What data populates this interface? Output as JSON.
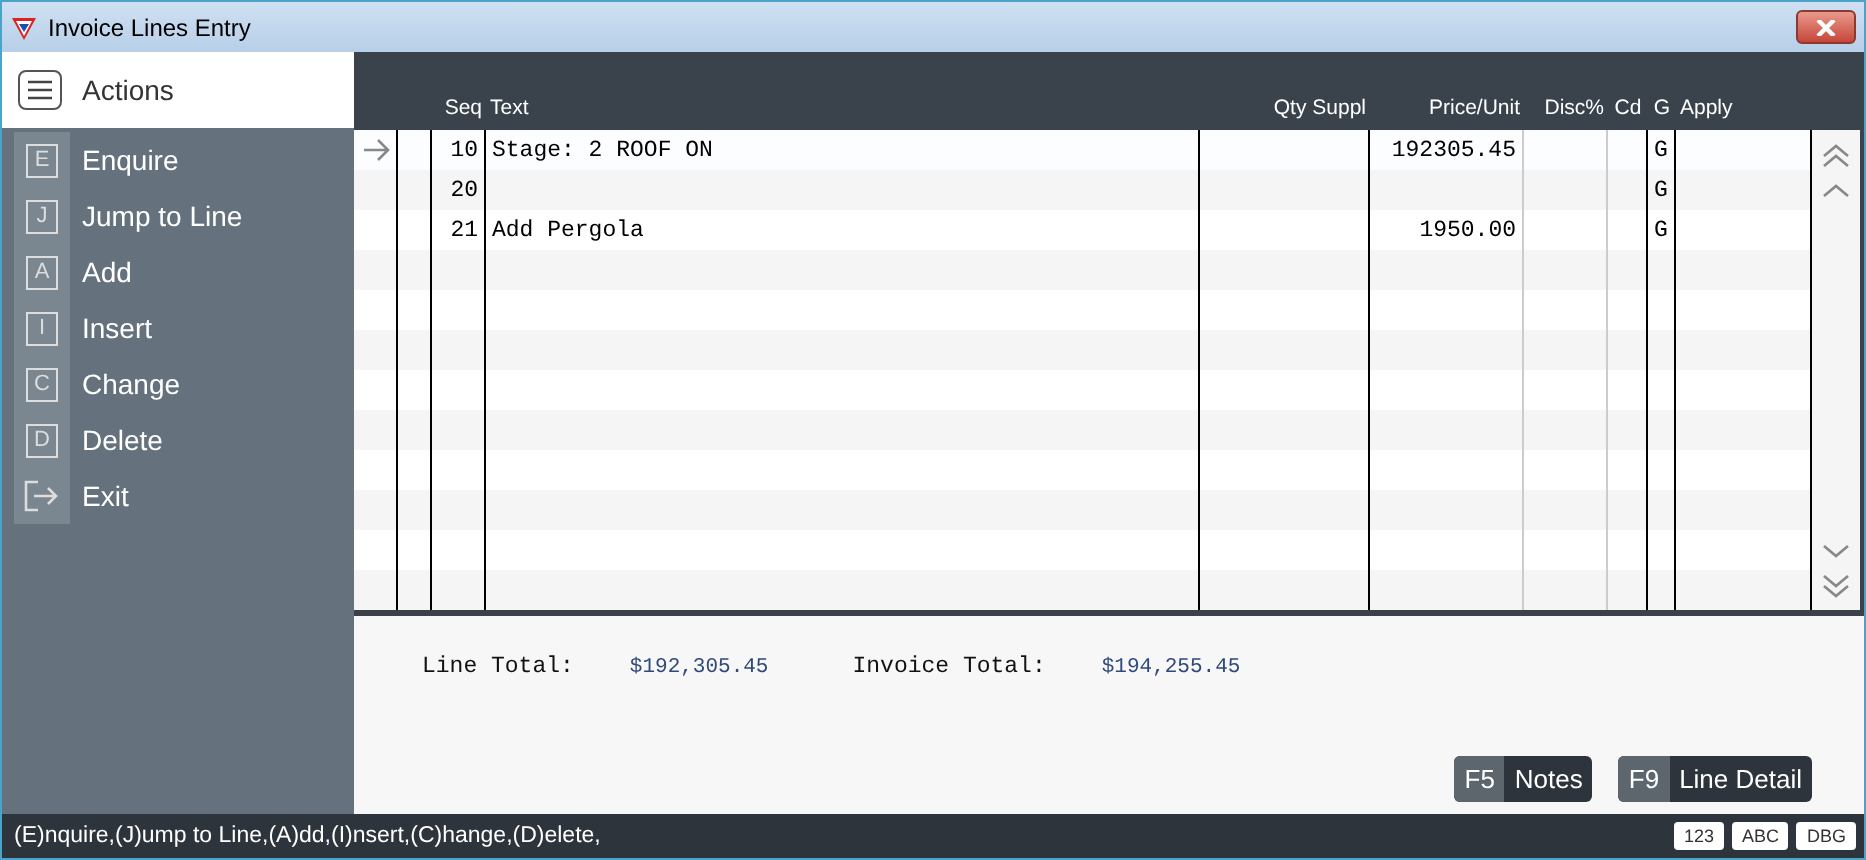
{
  "window": {
    "title": "Invoice Lines Entry"
  },
  "actions": {
    "title": "Actions",
    "items": [
      {
        "kind": "key",
        "key": "E",
        "label": "Enquire"
      },
      {
        "kind": "key",
        "key": "J",
        "label": "Jump to Line"
      },
      {
        "kind": "key",
        "key": "A",
        "label": "Add"
      },
      {
        "kind": "key",
        "key": "I",
        "label": "Insert"
      },
      {
        "kind": "key",
        "key": "C",
        "label": "Change"
      },
      {
        "kind": "key",
        "key": "D",
        "label": "Delete"
      },
      {
        "kind": "exit",
        "label": "Exit"
      }
    ]
  },
  "table": {
    "columns": [
      "Seq",
      "Text",
      "Qty Suppl",
      "Price/Unit",
      "Disc%",
      "Cd",
      "G",
      "Apply"
    ],
    "rows": [
      {
        "current": true,
        "seq": "10",
        "text": "Stage: 2 ROOF ON",
        "qty": "",
        "price": "192305.45",
        "disc": "",
        "cd": "",
        "g": "G",
        "apply": ""
      },
      {
        "current": false,
        "seq": "20",
        "text": "",
        "qty": "",
        "price": "",
        "disc": "",
        "cd": "",
        "g": "G",
        "apply": ""
      },
      {
        "current": false,
        "seq": "21",
        "text": "Add Pergola",
        "qty": "",
        "price": "1950.00",
        "disc": "",
        "cd": "",
        "g": "G",
        "apply": ""
      }
    ]
  },
  "totals": [
    {
      "label": "Line Total:",
      "value": "$192,305.45"
    },
    {
      "label": "Invoice Total:",
      "value": "$194,255.45"
    }
  ],
  "buttons": [
    {
      "key": "F5",
      "label": "Notes"
    },
    {
      "key": "F9",
      "label": "Line Detail"
    }
  ],
  "status_bar": {
    "text": "(E)nquire,(J)ump to Line,(A)dd,(I)nsert,(C)hange,(D)elete,",
    "badges": [
      "123",
      "ABC",
      "DBG"
    ]
  }
}
